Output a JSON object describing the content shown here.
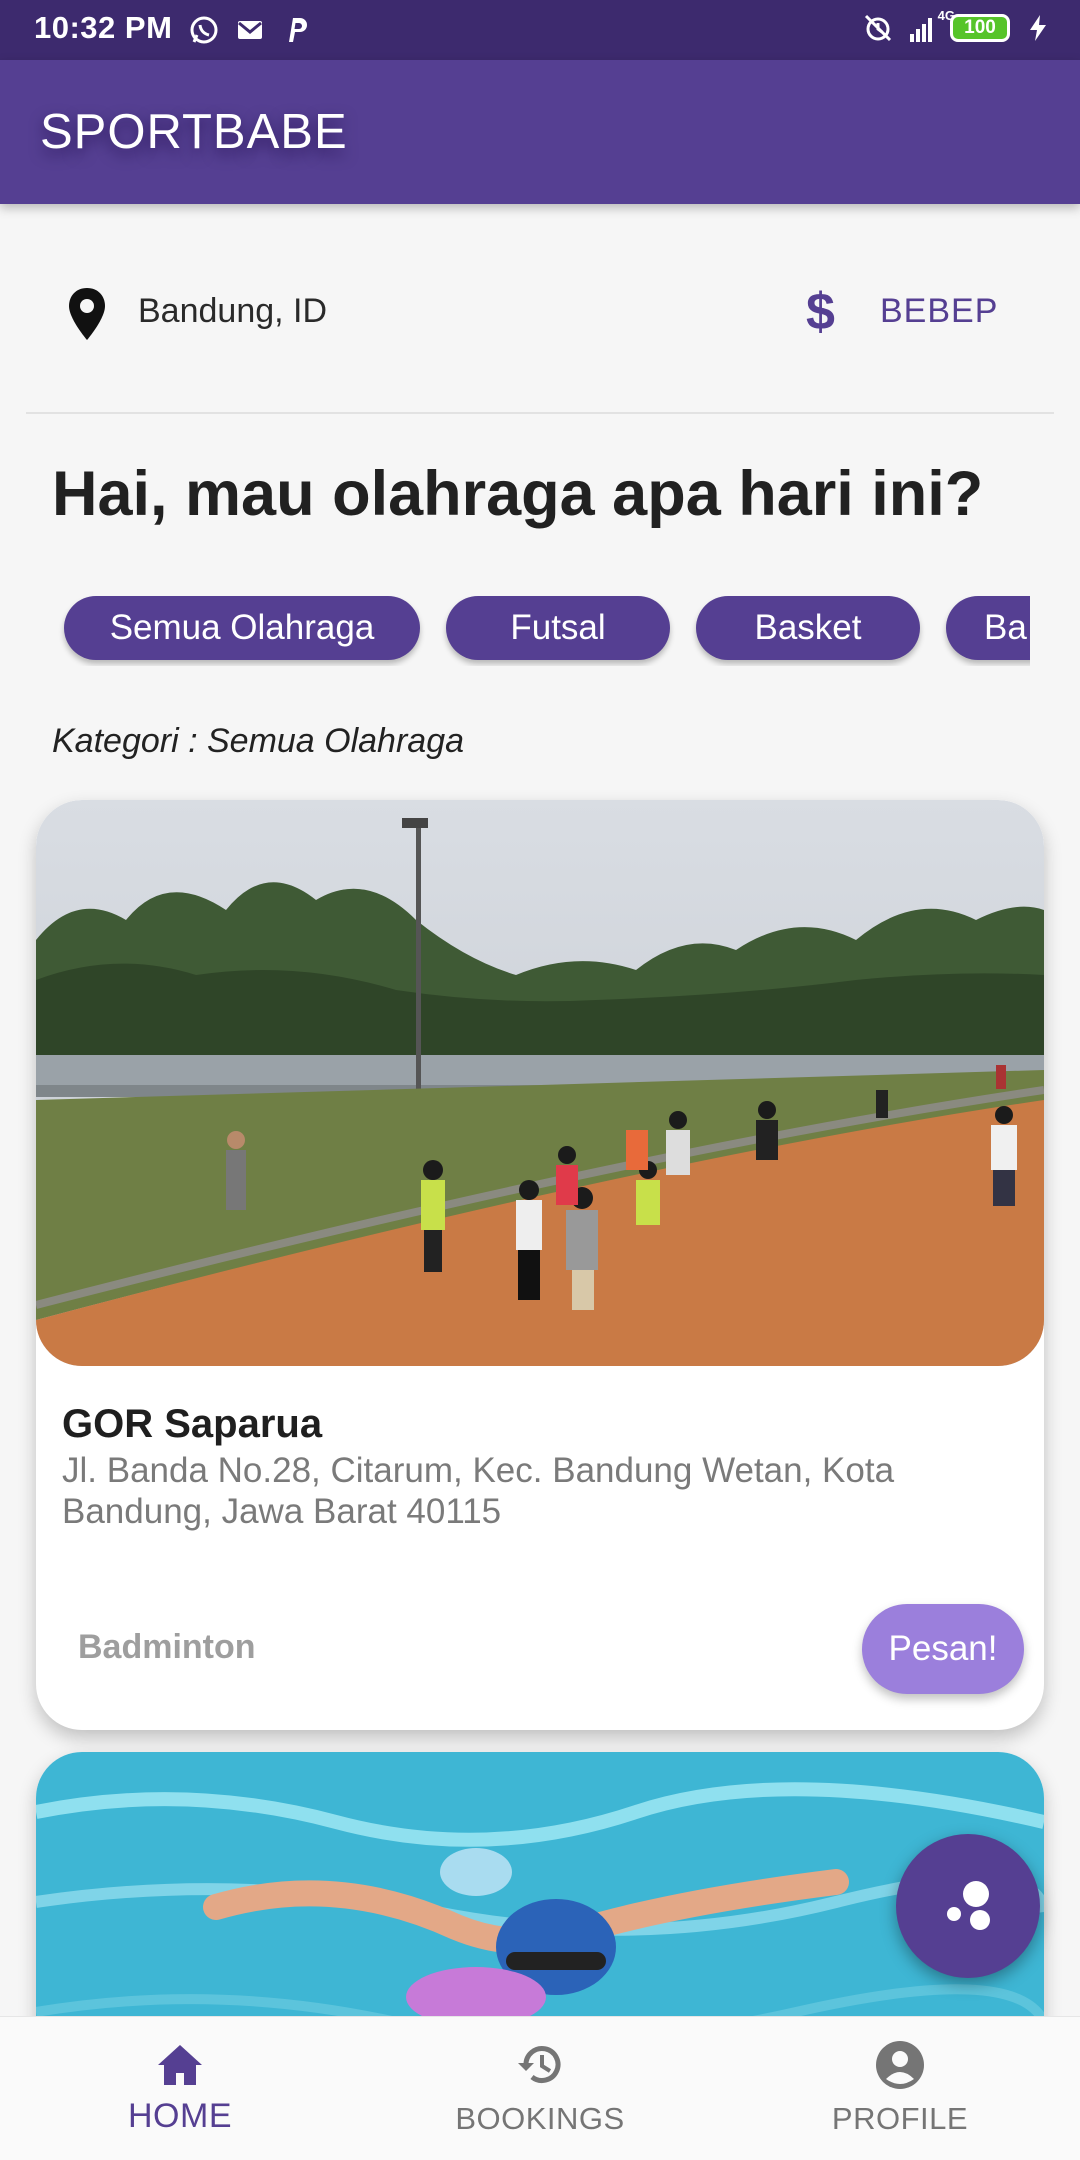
{
  "status_bar": {
    "time": "10:32 PM",
    "network": "4G",
    "battery": "100",
    "left_icons": [
      "whatsapp-icon",
      "gmail-icon",
      "paypal-icon"
    ],
    "right_icons": [
      "alarm-off-icon",
      "signal-icon",
      "battery-icon",
      "charging-icon"
    ]
  },
  "app_bar": {
    "title": "SPORTBABE"
  },
  "location": {
    "city": "Bandung, ID",
    "currency_label": "BEBEP",
    "currency_symbol": "$"
  },
  "greeting": "Hai, mau olahraga apa hari ini?",
  "chips": [
    "Semua Olahraga",
    "Futsal",
    "Basket",
    "Ba"
  ],
  "category": "Kategori : Semua Olahraga",
  "venues": [
    {
      "name": "GOR Saparua",
      "address": "Jl. Banda No.28, Citarum, Kec. Bandung Wetan, Kota Bandung, Jawa Barat 40115",
      "sport": "Badminton",
      "action": "Pesan!"
    }
  ],
  "bottom_nav": [
    {
      "label": "HOME",
      "icon": "home-icon",
      "active": true
    },
    {
      "label": "BOOKINGS",
      "icon": "history-icon",
      "active": false
    },
    {
      "label": "PROFILE",
      "icon": "account-icon",
      "active": false
    }
  ],
  "colors": {
    "primary": "#553f92",
    "status_bar": "#3d2a6e",
    "button": "#9b7fdc",
    "muted": "#757575"
  }
}
